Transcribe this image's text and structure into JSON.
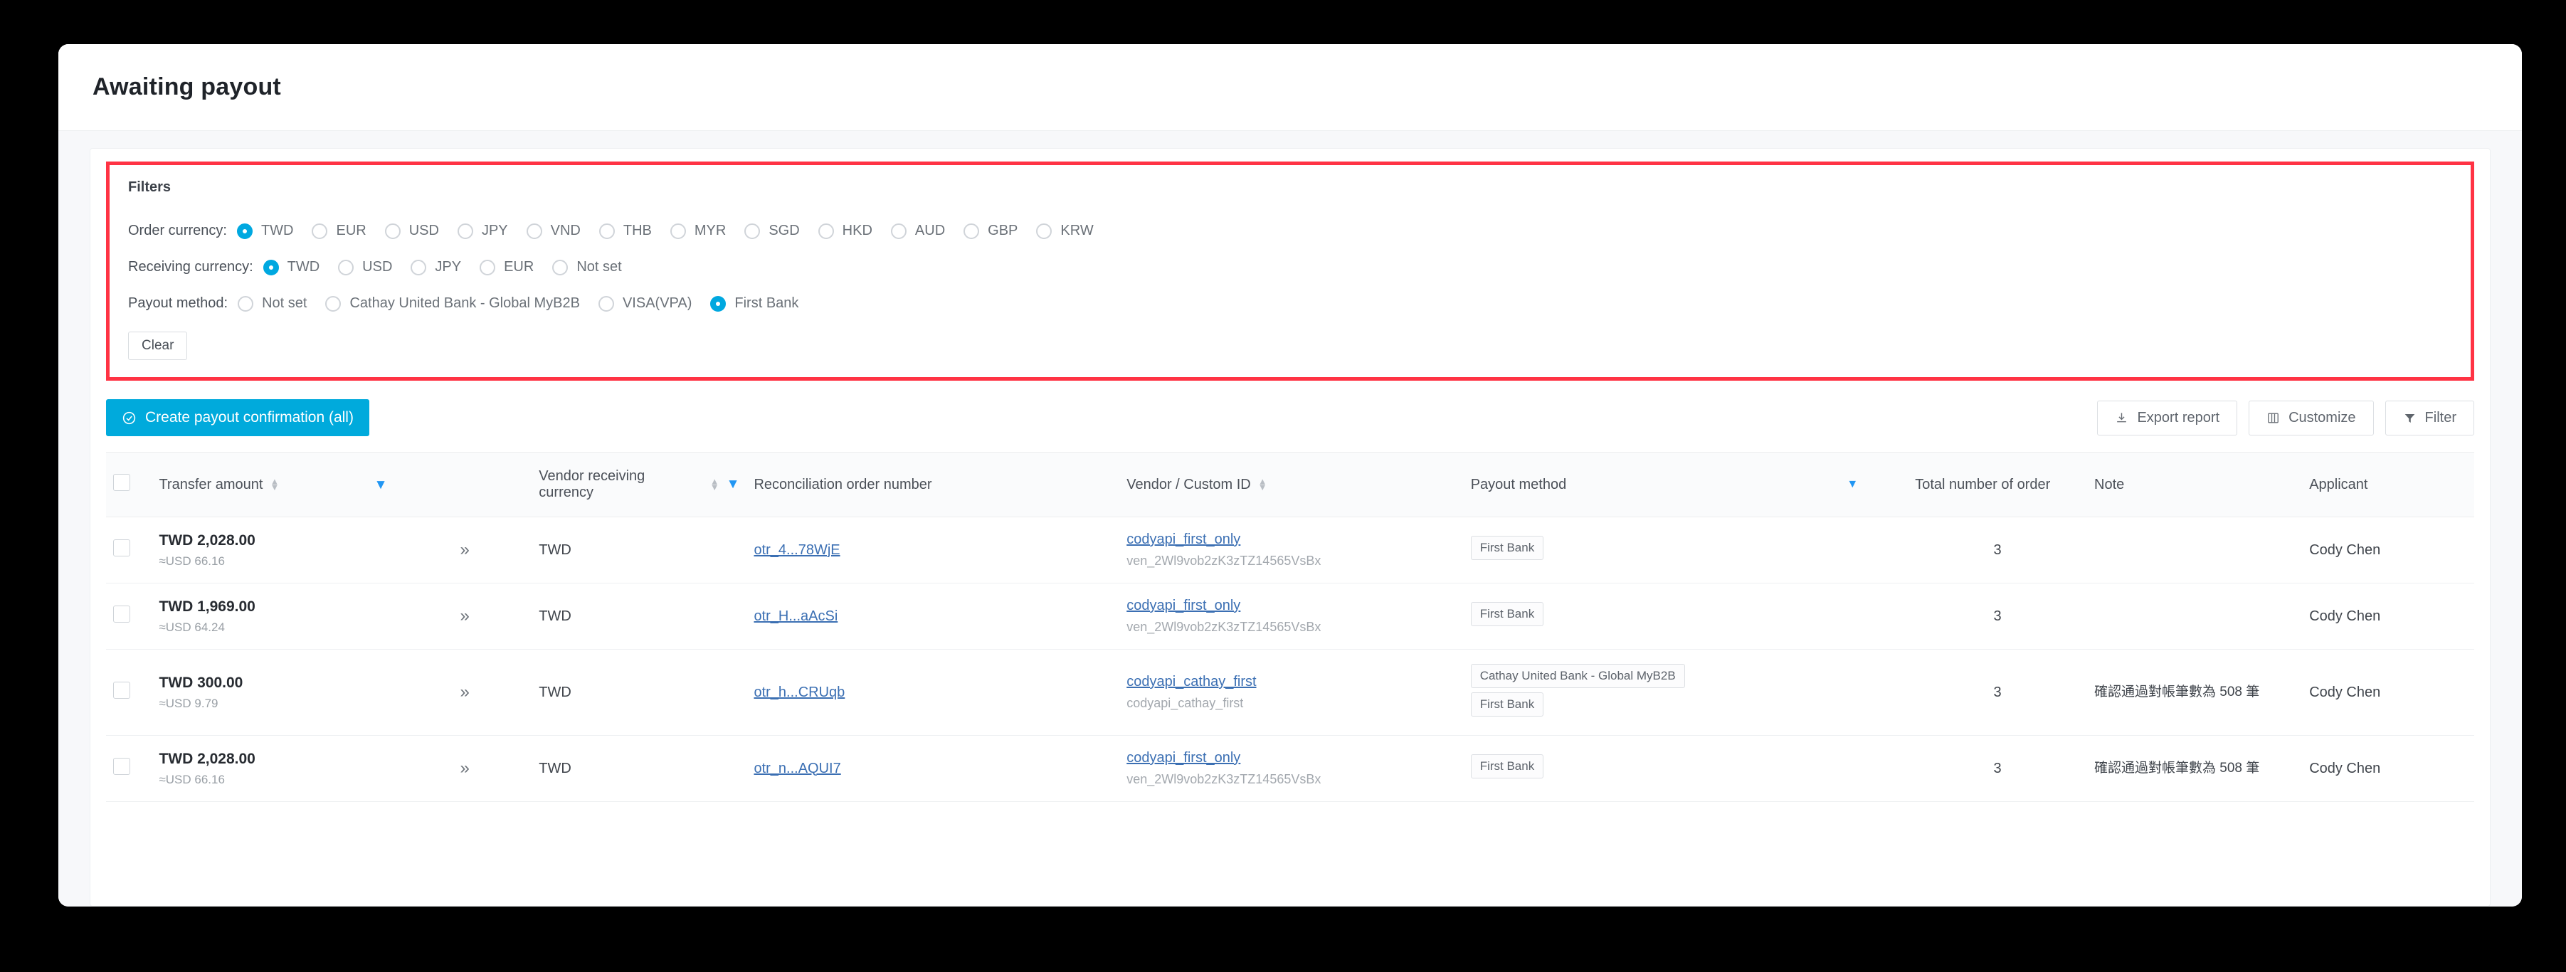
{
  "page": {
    "title": "Awaiting payout"
  },
  "filters": {
    "caption": "Filters",
    "rows": [
      {
        "label": "Order currency:",
        "options": [
          {
            "label": "TWD",
            "checked": true
          },
          {
            "label": "EUR",
            "checked": false
          },
          {
            "label": "USD",
            "checked": false
          },
          {
            "label": "JPY",
            "checked": false
          },
          {
            "label": "VND",
            "checked": false
          },
          {
            "label": "THB",
            "checked": false
          },
          {
            "label": "MYR",
            "checked": false
          },
          {
            "label": "SGD",
            "checked": false
          },
          {
            "label": "HKD",
            "checked": false
          },
          {
            "label": "AUD",
            "checked": false
          },
          {
            "label": "GBP",
            "checked": false
          },
          {
            "label": "KRW",
            "checked": false
          }
        ]
      },
      {
        "label": "Receiving currency:",
        "options": [
          {
            "label": "TWD",
            "checked": true
          },
          {
            "label": "USD",
            "checked": false
          },
          {
            "label": "JPY",
            "checked": false
          },
          {
            "label": "EUR",
            "checked": false
          },
          {
            "label": "Not set",
            "checked": false
          }
        ]
      },
      {
        "label": "Payout method:",
        "options": [
          {
            "label": "Not set",
            "checked": false
          },
          {
            "label": "Cathay United Bank - Global MyB2B",
            "checked": false
          },
          {
            "label": "VISA(VPA)",
            "checked": false
          },
          {
            "label": "First Bank",
            "checked": true
          }
        ]
      }
    ],
    "clear_label": "Clear",
    "highlight_color": "#ff3344"
  },
  "toolbar": {
    "primary_label": "Create payout confirmation (all)",
    "primary_icon": "check-circle-icon",
    "primary_color": "#00aadc",
    "export_label": "Export report",
    "export_icon": "download-icon",
    "customize_label": "Customize",
    "customize_icon": "columns-icon",
    "filter_label": "Filter",
    "filter_icon": "funnel-icon"
  },
  "table": {
    "columns": [
      {
        "key": "select",
        "label": ""
      },
      {
        "key": "transfer_amount",
        "label": "Transfer amount",
        "sortable": true
      },
      {
        "key": "amount_filter",
        "label": "",
        "filter": true
      },
      {
        "key": "arrow",
        "label": ""
      },
      {
        "key": "vendor_receiving_currency",
        "label": "Vendor receiving currency",
        "sortable": true,
        "filter": true
      },
      {
        "key": "reconciliation_order_number",
        "label": "Reconciliation order number"
      },
      {
        "key": "vendor_custom_id",
        "label": "Vendor / Custom ID",
        "sortable": true
      },
      {
        "key": "payout_method",
        "label": "Payout method",
        "filter": true
      },
      {
        "key": "total_number_of_order",
        "label": "Total number of order"
      },
      {
        "key": "note",
        "label": "Note"
      },
      {
        "key": "applicant",
        "label": "Applicant"
      }
    ],
    "rows": [
      {
        "amount": "TWD 2,028.00",
        "amount_usd": "≈USD 66.16",
        "arrow": "»",
        "receiving_currency": "TWD",
        "recon_order": "otr_4...78WjE",
        "vendor_name": "codyapi_first_only",
        "vendor_id": "ven_2Wl9vob2zK3zTZ14565VsBx",
        "payout_methods": [
          "First Bank"
        ],
        "total_orders": "3",
        "note": "",
        "applicant": "Cody Chen"
      },
      {
        "amount": "TWD 1,969.00",
        "amount_usd": "≈USD 64.24",
        "arrow": "»",
        "receiving_currency": "TWD",
        "recon_order": "otr_H...aAcSi",
        "vendor_name": "codyapi_first_only",
        "vendor_id": "ven_2Wl9vob2zK3zTZ14565VsBx",
        "payout_methods": [
          "First Bank"
        ],
        "total_orders": "3",
        "note": "",
        "applicant": "Cody Chen"
      },
      {
        "amount": "TWD 300.00",
        "amount_usd": "≈USD 9.79",
        "arrow": "»",
        "receiving_currency": "TWD",
        "recon_order": "otr_h...CRUqb",
        "vendor_name": "codyapi_cathay_first",
        "vendor_id": "codyapi_cathay_first",
        "payout_methods": [
          "Cathay United Bank - Global MyB2B",
          "First Bank"
        ],
        "total_orders": "3",
        "note": "確認通過對帳筆數為 508 筆",
        "applicant": "Cody Chen"
      },
      {
        "amount": "TWD 2,028.00",
        "amount_usd": "≈USD 66.16",
        "arrow": "»",
        "receiving_currency": "TWD",
        "recon_order": "otr_n...AQUI7",
        "vendor_name": "codyapi_first_only",
        "vendor_id": "ven_2Wl9vob2zK3zTZ14565VsBx",
        "payout_methods": [
          "First Bank"
        ],
        "total_orders": "3",
        "note": "確認通過對帳筆數為 508 筆",
        "applicant": "Cody Chen"
      }
    ]
  }
}
